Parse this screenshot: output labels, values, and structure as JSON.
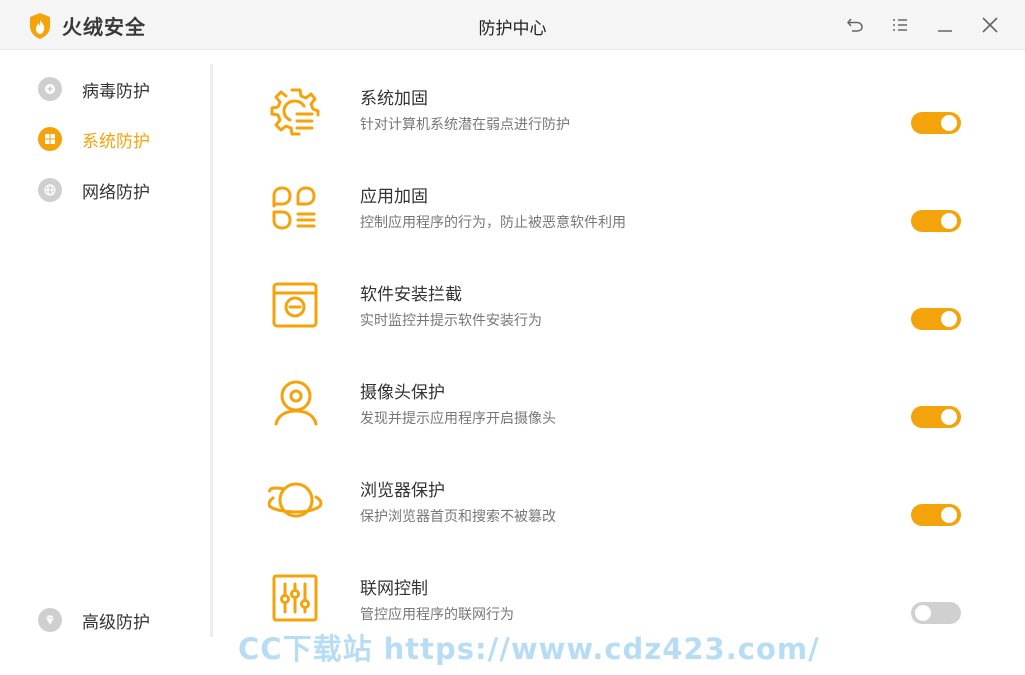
{
  "app": {
    "name": "火绒安全",
    "window_title": "防护中心"
  },
  "colors": {
    "accent": "#f5a30a",
    "toggle_off": "#d0d0d0",
    "nav_icon": "#cfcfcf"
  },
  "window_controls": [
    {
      "name": "back-icon"
    },
    {
      "name": "menu-icon"
    },
    {
      "name": "minimize-icon"
    },
    {
      "name": "close-icon"
    }
  ],
  "sidebar": {
    "items": [
      {
        "label": "病毒防护",
        "icon": "plus-shield-icon",
        "active": false
      },
      {
        "label": "系统防护",
        "icon": "windows-icon",
        "active": true
      },
      {
        "label": "网络防护",
        "icon": "globe-icon",
        "active": false
      }
    ],
    "bottom_item": {
      "label": "高级防护",
      "icon": "diamond-icon"
    }
  },
  "features": [
    {
      "title": "系统加固",
      "desc": "针对计算机系统潜在弱点进行防护",
      "icon": "gear-icon",
      "enabled": true
    },
    {
      "title": "应用加固",
      "desc": "控制应用程序的行为，防止被恶意软件利用",
      "icon": "apps-icon",
      "enabled": true
    },
    {
      "title": "软件安装拦截",
      "desc": "实时监控并提示软件安装行为",
      "icon": "install-box-icon",
      "enabled": true
    },
    {
      "title": "摄像头保护",
      "desc": "发现并提示应用程序开启摄像头",
      "icon": "webcam-icon",
      "enabled": true
    },
    {
      "title": "浏览器保护",
      "desc": "保护浏览器首页和搜索不被篡改",
      "icon": "planet-icon",
      "enabled": true
    },
    {
      "title": "联网控制",
      "desc": "管控应用程序的联网行为",
      "icon": "sliders-icon",
      "enabled": false
    }
  ],
  "watermark": "CC下载站 https://www.cdz423.com/"
}
